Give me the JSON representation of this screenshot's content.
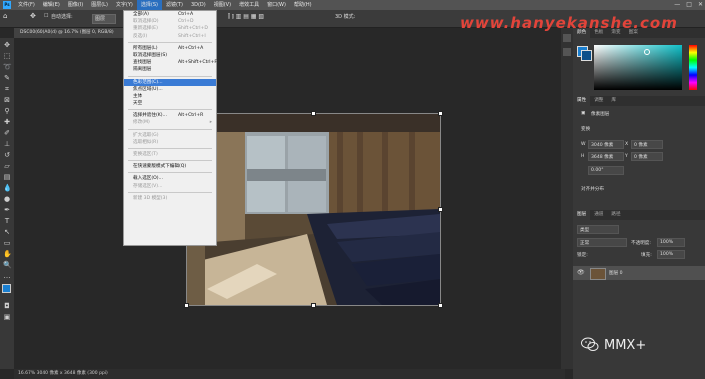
{
  "menubar": {
    "logo": "Ps",
    "items": [
      "文件(F)",
      "编辑(E)",
      "图像(I)",
      "图层(L)",
      "文字(Y)",
      "选择(S)",
      "滤镜(T)",
      "3D(D)",
      "视图(V)",
      "增效工具",
      "窗口(W)",
      "帮助(H)"
    ],
    "active_index": 5,
    "window_controls": [
      "—",
      "□",
      "✕"
    ]
  },
  "options": {
    "auto_select_label": "自动选择:",
    "auto_select_value": "图层",
    "mode_3d": "3D 模式:"
  },
  "watermark": "www.hanyekanshe.com",
  "document": {
    "tab_title": "DSC00(60)A0(d) @ 16.7% (图层 0, RGB/8)",
    "status": "16.67%   3040 像素 x 3648 像素 (300 ppi)"
  },
  "select_menu": {
    "items": [
      {
        "label": "全部(A)",
        "shortcut": "Ctrl+A",
        "enabled": true
      },
      {
        "label": "取消选择(D)",
        "shortcut": "Ctrl+D",
        "enabled": false
      },
      {
        "label": "重新选择(E)",
        "shortcut": "Shift+Ctrl+D",
        "enabled": false
      },
      {
        "label": "反选(I)",
        "shortcut": "Shift+Ctrl+I",
        "enabled": false
      },
      {
        "sep": true
      },
      {
        "label": "所有图层(L)",
        "shortcut": "Alt+Ctrl+A",
        "enabled": true
      },
      {
        "label": "取消选择图层(S)",
        "shortcut": "",
        "enabled": true
      },
      {
        "label": "查找图层",
        "shortcut": "Alt+Shift+Ctrl+F",
        "enabled": true
      },
      {
        "label": "隔离图层",
        "shortcut": "",
        "enabled": true
      },
      {
        "sep": true
      },
      {
        "label": "色彩范围(C)...",
        "shortcut": "",
        "enabled": true,
        "highlighted": true
      },
      {
        "label": "焦点区域(U)...",
        "shortcut": "",
        "enabled": true
      },
      {
        "label": "主体",
        "shortcut": "",
        "enabled": true
      },
      {
        "label": "天空",
        "shortcut": "",
        "enabled": true
      },
      {
        "sep": true
      },
      {
        "label": "选择并遮住(K)...",
        "shortcut": "Alt+Ctrl+R",
        "enabled": true
      },
      {
        "label": "修改(M)",
        "shortcut": "",
        "enabled": false,
        "submenu": true
      },
      {
        "sep": true
      },
      {
        "label": "扩大选取(G)",
        "shortcut": "",
        "enabled": false
      },
      {
        "label": "选取相似(R)",
        "shortcut": "",
        "enabled": false
      },
      {
        "sep": true
      },
      {
        "label": "变换选区(T)",
        "shortcut": "",
        "enabled": false
      },
      {
        "sep": true
      },
      {
        "label": "在快速蒙版模式下编辑(Q)",
        "shortcut": "",
        "enabled": true
      },
      {
        "sep": true
      },
      {
        "label": "载入选区(O)...",
        "shortcut": "",
        "enabled": true
      },
      {
        "label": "存储选区(V)...",
        "shortcut": "",
        "enabled": false
      },
      {
        "sep": true
      },
      {
        "label": "新建 3D 模型(3)",
        "shortcut": "",
        "enabled": false
      }
    ]
  },
  "panels": {
    "color_tabs": [
      "颜色",
      "色板",
      "渐变",
      "图案"
    ],
    "props_tabs": [
      "属性",
      "调整",
      "库"
    ],
    "pixel_layer": "像素图层",
    "transform_title": "变换",
    "w_label": "W",
    "w_value": "3040 像素",
    "h_label": "H",
    "h_value": "3648 像素",
    "x_value": "0 像素",
    "y_value": "0 像素",
    "angle_value": "0.00°",
    "align_title": "对齐并分布",
    "layers_tabs": [
      "图层",
      "通道",
      "路径"
    ],
    "kind_label": "类型",
    "blend_mode": "正常",
    "opacity_label": "不透明度:",
    "opacity_value": "100%",
    "lock_label": "锁定:",
    "fill_label": "填充:",
    "fill_value": "100%",
    "layer_name": "图层 0"
  },
  "wechat_label": "MMX+",
  "colors": {
    "accent": "#3a7bd5",
    "ps_blue": "#31a8ff",
    "watermark": "#e2443a"
  }
}
